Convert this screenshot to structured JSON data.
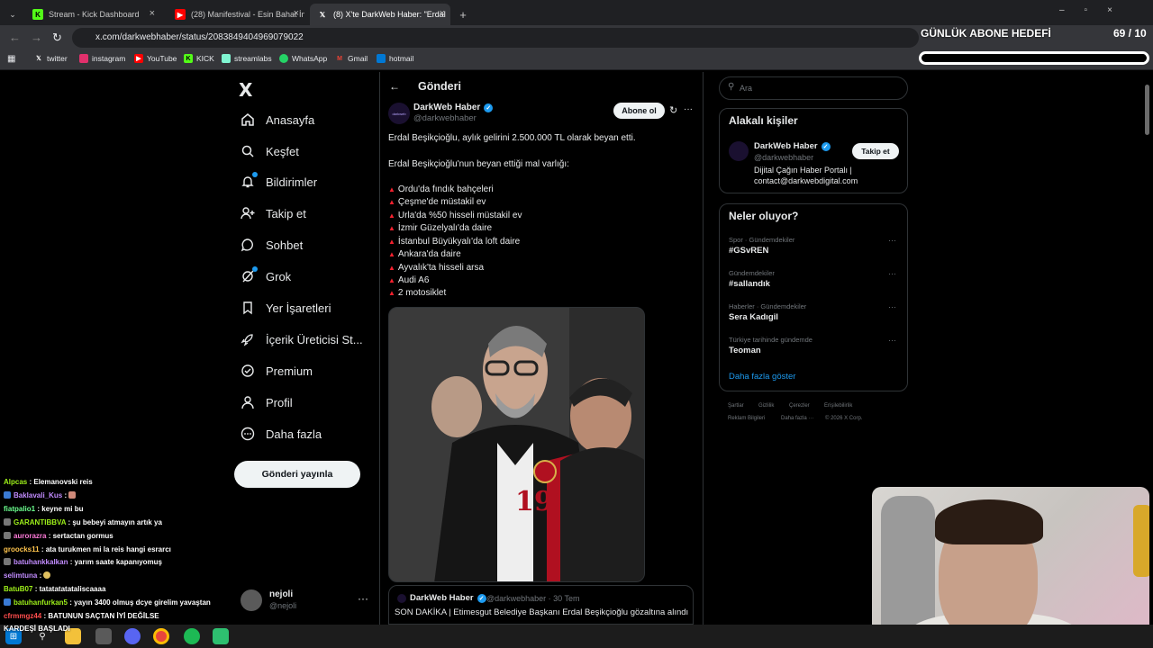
{
  "browser": {
    "tabs": [
      {
        "label": "Stream - Kick Dashboard",
        "icon": "kick-icon",
        "color": "#53fc18"
      },
      {
        "label": "(28) Manifestival - Esin Bahat İn",
        "icon": "youtube-icon",
        "color": "#ff0000"
      },
      {
        "label": "(8) X'te DarkWeb Haber: \"Erdal",
        "icon": "x-icon",
        "color": "#ffffff"
      }
    ],
    "new_tab": "+",
    "url": "x.com/darkwebhaber/status/2083849404969079022",
    "bookmarks": [
      {
        "label": "twitter",
        "icon": "x-icon"
      },
      {
        "label": "instagram",
        "icon": "instagram-icon"
      },
      {
        "label": "YouTube",
        "icon": "youtube-icon"
      },
      {
        "label": "KICK",
        "icon": "kick-icon"
      },
      {
        "label": "streamlabs",
        "icon": "streamlabs-icon"
      },
      {
        "label": "WhatsApp",
        "icon": "whatsapp-icon"
      },
      {
        "label": "Gmail",
        "icon": "gmail-icon"
      },
      {
        "label": "hotmail",
        "icon": "hotmail-icon"
      }
    ]
  },
  "overlay": {
    "goal_title": "GÜNLÜK ABONE HEDEFİ",
    "goal_count": "69 / 10"
  },
  "nav": {
    "logo": "X",
    "items": [
      {
        "label": "Anasayfa",
        "icon": "home-icon"
      },
      {
        "label": "Keşfet",
        "icon": "search-icon"
      },
      {
        "label": "Bildirimler",
        "icon": "bell-icon"
      },
      {
        "label": "Takip et",
        "icon": "follow-icon"
      },
      {
        "label": "Sohbet",
        "icon": "chat-icon"
      },
      {
        "label": "Grok",
        "icon": "grok-icon"
      },
      {
        "label": "Yer İşaretleri",
        "icon": "bookmark-icon"
      },
      {
        "label": "İçerik Üreticisi St...",
        "icon": "rocket-icon"
      },
      {
        "label": "Premium",
        "icon": "premium-icon"
      },
      {
        "label": "Profil",
        "icon": "profile-icon"
      },
      {
        "label": "Daha fazla",
        "icon": "more-icon"
      }
    ],
    "post_button": "Gönderi yayınla",
    "account": {
      "name": "nejoli",
      "handle": "@nejoli"
    }
  },
  "post": {
    "header": "Gönderi",
    "author": "DarkWeb Haber",
    "handle": "@darkwebhaber",
    "avatar_text": "darkweb",
    "subscribe": "Abone ol",
    "line1": "Erdal Beşikçioğlu, aylık gelirini 2.500.000 TL olarak beyan etti.",
    "line2": "Erdal Beşikçioğlu'nun beyan ettiği mal varlığı:",
    "assets": [
      "Ordu'da fındık bahçeleri",
      "Çeşme'de müstakil ev",
      "Urla'da %50 hisseli müstakil ev",
      "İzmir Güzelyalı'da daire",
      "İstanbul Büyükyalı'da loft daire",
      "Ankara'da daire",
      "Ayvalık'ta hisseli arsa",
      "Audi A6",
      "2 motosiklet"
    ],
    "quote": {
      "author": "DarkWeb Haber",
      "meta": "@darkwebhaber · 30 Tem",
      "text": "SON DAKİKA | Etimesgut Belediye Başkanı Erdal Beşikçioğlu gözaltına alındı"
    }
  },
  "right": {
    "search_placeholder": "Ara",
    "related_title": "Alakalı kişiler",
    "related": {
      "name": "DarkWeb Haber",
      "handle": "@darkwebhaber",
      "bio1": "Dijital Çağın Haber Portalı |",
      "bio2": "contact@darkwebdigital.com",
      "follow": "Takip et"
    },
    "trends_title": "Neler oluyor?",
    "trends": [
      {
        "cat": "Spor · Gündemdekiler",
        "name": "#GSvREN"
      },
      {
        "cat": "Gündemdekiler",
        "name": "#sallandık"
      },
      {
        "cat": "Haberler · Gündemdekiler",
        "name": "Sera Kadıgil"
      },
      {
        "cat": "Türkiye tarihinde gündemde",
        "name": "Teoman"
      }
    ],
    "show_more": "Daha fazla göster",
    "footer1": [
      "Şartlar",
      "Gizlilik",
      "Çerezler",
      "Erişilebilirlik"
    ],
    "footer2": [
      "Reklam Bilgileri",
      "Daha fazla ···",
      "© 2026 X Corp."
    ]
  },
  "chat": [
    {
      "user": "Alpcas",
      "msg": ": Elemanovski reis",
      "color": "#9ef01a"
    },
    {
      "user": "Baklavali_Kus",
      "msg": ":",
      "color": "#c28cff"
    },
    {
      "user": "fiatpalio1",
      "msg": ": keyne mi bu",
      "color": "#6bff8f"
    },
    {
      "user": "GARANTIBBVA",
      "msg": ": şu bebeyi atmayın artık ya",
      "color": "#9ef01a"
    },
    {
      "user": "aurorazra",
      "msg": ": sertactan gormus",
      "color": "#ff7ad9"
    },
    {
      "user": "groocks11",
      "msg": ": ata turukmen mi la reis hangi esrarcı",
      "color": "#ffc44d"
    },
    {
      "user": "batuhankkalkan",
      "msg": ": yarım saate kapanıyomuş",
      "color": "#c28cff"
    },
    {
      "user": "selimtuna",
      "msg": ":",
      "color": "#c28cff"
    },
    {
      "user": "BatuB07",
      "msg": ": tatatatatataliscaaaa",
      "color": "#9ef01a"
    },
    {
      "user": "batuhanfurkan5",
      "msg": ": yayın 3400 olmuş dcye girelim yavaştan",
      "color": "#9ef01a"
    },
    {
      "user": "cfrmmgz44",
      "msg": ": BATUNUN SAÇTAN İYİ DEĞİLSE",
      "color": "#ff4d4d"
    },
    {
      "user": "",
      "msg": "KARDEŞİ BAŞLADI",
      "color": "#ffffff"
    }
  ]
}
